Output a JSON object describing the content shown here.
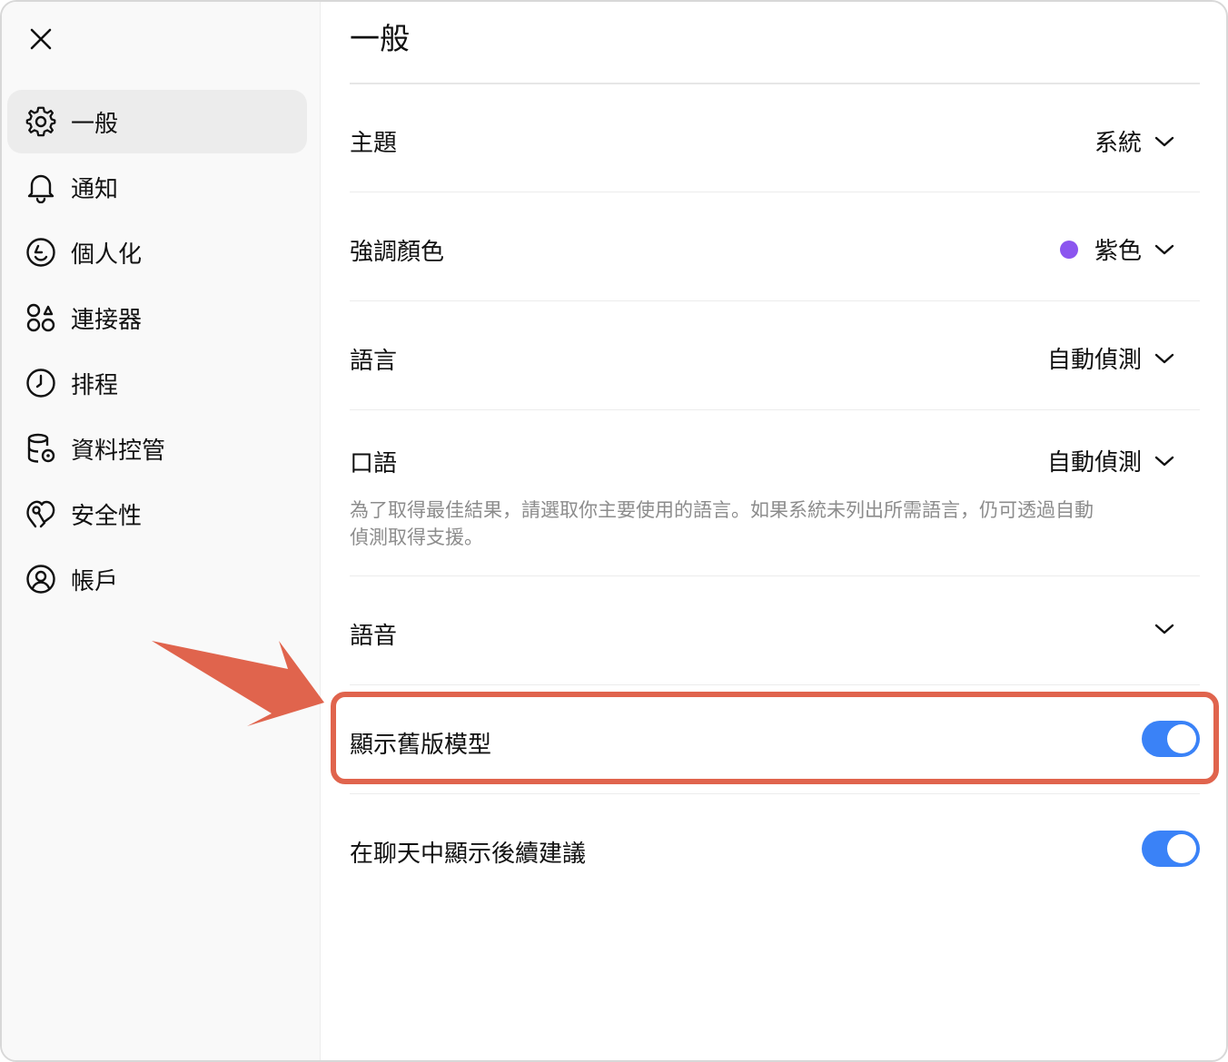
{
  "colors": {
    "accent_blue": "#3a82f7",
    "purple_dot": "#8b55ef",
    "annotation_red": "#e0644d"
  },
  "sidebar": {
    "close_icon": "close-icon",
    "items": [
      {
        "label": "一般",
        "icon": "gear-icon",
        "active": true
      },
      {
        "label": "通知",
        "icon": "bell-icon",
        "active": false
      },
      {
        "label": "個人化",
        "icon": "personalize-icon",
        "active": false
      },
      {
        "label": "連接器",
        "icon": "connectors-icon",
        "active": false
      },
      {
        "label": "排程",
        "icon": "clock-icon",
        "active": false
      },
      {
        "label": "資料控管",
        "icon": "database-gear-icon",
        "active": false
      },
      {
        "label": "安全性",
        "icon": "security-icon",
        "active": false
      },
      {
        "label": "帳戶",
        "icon": "account-icon",
        "active": false
      }
    ]
  },
  "main": {
    "title": "一般",
    "settings": {
      "theme": {
        "label": "主題",
        "value": "系統"
      },
      "accent_color": {
        "label": "強調顏色",
        "value": "紫色"
      },
      "language": {
        "label": "語言",
        "value": "自動偵測"
      },
      "spoken_language": {
        "label": "口語",
        "value": "自動偵測",
        "description": "為了取得最佳結果，請選取你主要使用的語言。如果系統未列出所需語言，仍可透過自動偵測取得支援。"
      },
      "voice": {
        "label": "語音"
      },
      "show_legacy_models": {
        "label": "顯示舊版模型",
        "enabled": true
      },
      "follow_up_suggestions": {
        "label": "在聊天中顯示後續建議",
        "enabled": true
      }
    }
  }
}
